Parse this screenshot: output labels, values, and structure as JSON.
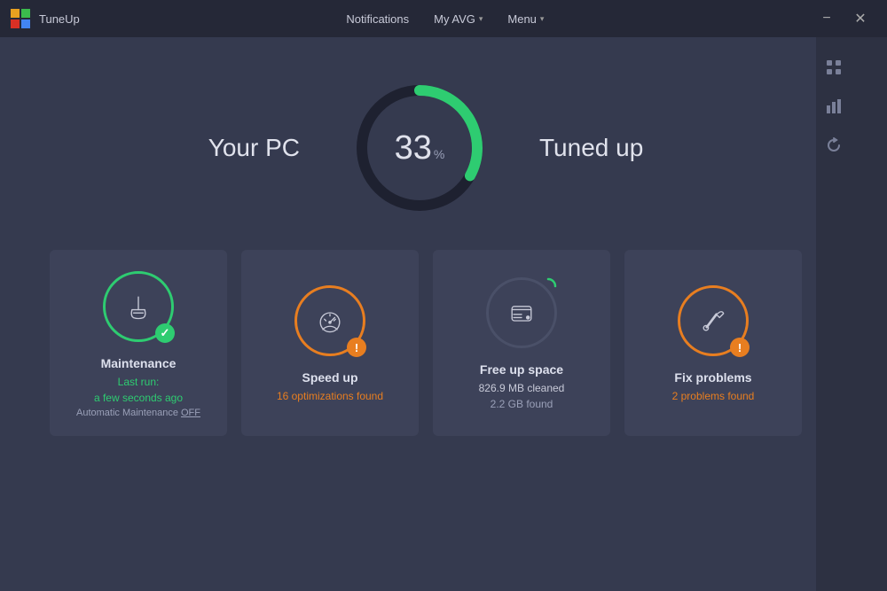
{
  "app": {
    "logo_alt": "AVG logo",
    "title": "TuneUp"
  },
  "titlebar": {
    "notifications": "Notifications",
    "my_avg": "My AVG",
    "menu": "Menu",
    "minimize": "−",
    "close": "✕"
  },
  "gauge": {
    "your_pc_label": "Your PC",
    "tuned_up_label": "Tuned up",
    "value": "33",
    "unit": "%",
    "progress_pct": 33
  },
  "cards": [
    {
      "id": "maintenance",
      "title": "Maintenance",
      "subtitle_line1": "Last run:",
      "subtitle_line2": "a few seconds ago",
      "subtitle_line3": "Automatic Maintenance",
      "link_text": "OFF",
      "icon_type": "broom",
      "ring_color": "green",
      "badge_type": "success"
    },
    {
      "id": "speed-up",
      "title": "Speed up",
      "subtitle_line1": "16 optimizations found",
      "icon_type": "speedometer",
      "ring_color": "orange",
      "badge_type": "warning"
    },
    {
      "id": "free-space",
      "title": "Free up space",
      "subtitle_line1": "826.9 MB cleaned",
      "subtitle_line2": "2.2 GB found",
      "icon_type": "disk",
      "ring_color": "dark",
      "badge_type": null
    },
    {
      "id": "fix-problems",
      "title": "Fix problems",
      "subtitle_line1": "2 problems found",
      "icon_type": "wrench",
      "ring_color": "orange2",
      "badge_type": "warning"
    }
  ],
  "sidebar_icons": [
    {
      "name": "grid-icon",
      "symbol": "⊞"
    },
    {
      "name": "bar-chart-icon",
      "symbol": "▦"
    },
    {
      "name": "refresh-icon",
      "symbol": "↺"
    }
  ]
}
